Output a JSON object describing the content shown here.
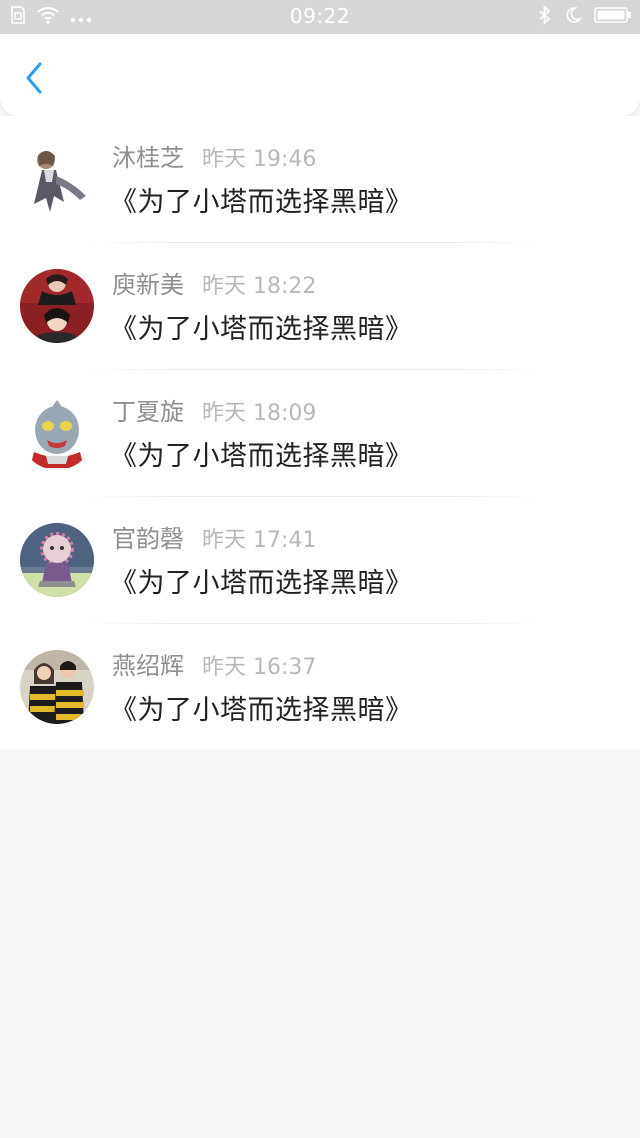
{
  "status_bar": {
    "time": "09:22",
    "left_icons": [
      "sim-icon",
      "wifi-icon",
      "more-dots-icon"
    ],
    "right_icons": [
      "bluetooth-icon",
      "moon-icon",
      "battery-icon"
    ]
  },
  "nav": {
    "back_icon": "chevron-left-icon",
    "accent_color": "#2b9cf0"
  },
  "comments": [
    {
      "name": "沐桂芝",
      "time": "昨天 19:46",
      "message": "《为了小塔而选择黑暗》",
      "avatar": "anime-girl-avatar"
    },
    {
      "name": "庾新美",
      "time": "昨天 18:22",
      "message": "《为了小塔而选择黑暗》",
      "avatar": "photo-avatar"
    },
    {
      "name": "丁夏旋",
      "time": "昨天 18:09",
      "message": "《为了小塔而选择黑暗》",
      "avatar": "ultraman-avatar"
    },
    {
      "name": "官韵磬",
      "time": "昨天 17:41",
      "message": "《为了小塔而选择黑暗》",
      "avatar": "doll-avatar"
    },
    {
      "name": "燕绍辉",
      "time": "昨天 16:37",
      "message": "《为了小塔而选择黑暗》",
      "avatar": "couple-avatar"
    }
  ]
}
